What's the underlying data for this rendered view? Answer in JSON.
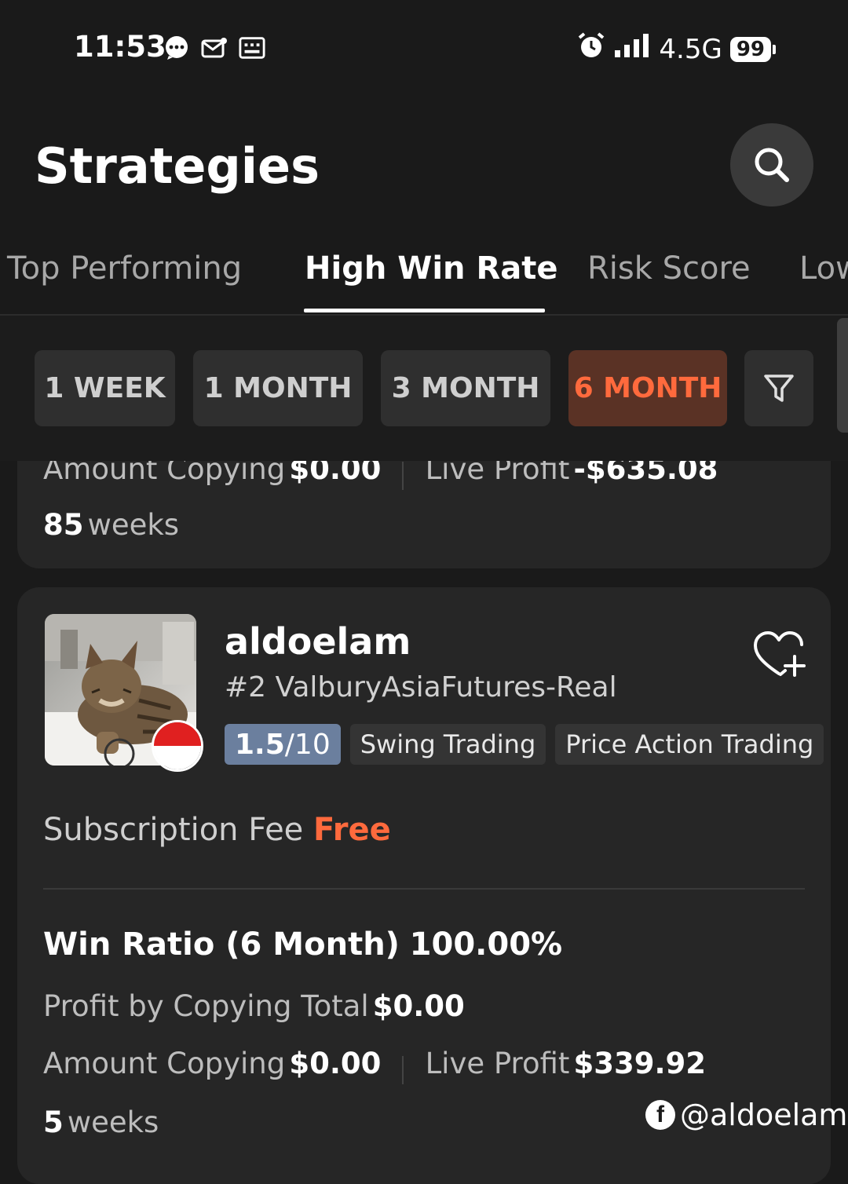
{
  "status_bar": {
    "time": "11:53",
    "network": "4.5G",
    "battery": "99",
    "icons": [
      "chat-icon",
      "mail-icon",
      "keyboard-icon",
      "alarm-icon",
      "signal-icon"
    ]
  },
  "header": {
    "title": "Strategies",
    "search_icon": "search-icon"
  },
  "tabs": [
    {
      "label": "Top Performing",
      "active": false
    },
    {
      "label": "High Win Rate",
      "active": true
    },
    {
      "label": "Risk Score",
      "active": false
    },
    {
      "label": "Low",
      "active": false
    }
  ],
  "filters": {
    "periods": [
      "1 WEEK",
      "1 MONTH",
      "3 MONTH",
      "6 MONTH"
    ],
    "selected": "6 MONTH",
    "filter_icon": "funnel-icon"
  },
  "previous_card": {
    "amount_copying_label": "Amount Copying",
    "amount_copying_value": "$0.00",
    "live_profit_label": "Live Profit",
    "live_profit_value": "-$635.08",
    "duration_number": "85",
    "duration_unit": "weeks"
  },
  "strategy": {
    "name": "aldoelam",
    "rank_account": "#2 ValburyAsiaFutures-Real",
    "risk_score": "1.5",
    "risk_score_max": "/10",
    "tags": [
      "Swing Trading",
      "Price Action Trading"
    ],
    "subscription_fee_label": "Subscription Fee",
    "subscription_fee_value": "Free",
    "win_ratio_label": "Win Ratio (6 Month)",
    "win_ratio_value": "100.00%",
    "profit_copying_label": "Profit by Copying Total",
    "profit_copying_value": "$0.00",
    "amount_copying_label": "Amount Copying",
    "amount_copying_value": "$0.00",
    "live_profit_label": "Live Profit",
    "live_profit_value": "$339.92",
    "duration_number": "5",
    "duration_unit": "weeks",
    "favorite_icon": "heart-plus-icon",
    "country_flag": "indonesia-flag-icon"
  },
  "watermark": {
    "text": "@aldoelam",
    "icon": "facebook-icon"
  },
  "colors": {
    "background": "#1a1a1a",
    "card": "#262626",
    "accent": "#ff6a3d",
    "chip_active_bg": "#5a3225",
    "score_badge": "#6b7f9e"
  }
}
